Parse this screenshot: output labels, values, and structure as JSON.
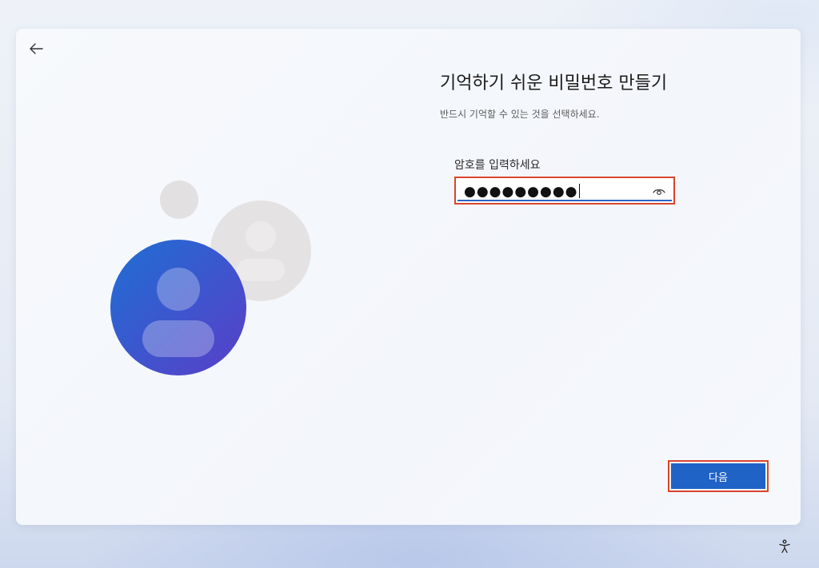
{
  "page": {
    "title": "기억하기 쉬운 비밀번호 만들기",
    "subtitle": "반드시 기억할 수 있는 것을 선택하세요."
  },
  "password_field": {
    "label": "암호를 입력하세요",
    "masked_value": "●●●●●●●●●",
    "reveal_icon": "eye-icon"
  },
  "buttons": {
    "next_label": "다음",
    "back_icon": "arrow-left-icon",
    "accessibility_icon": "accessibility-icon"
  },
  "colors": {
    "accent": "#1f63c6",
    "highlight_border": "#d9452c",
    "avatar_gradient_start": "#1e6fd4",
    "avatar_gradient_end": "#5a3ec8",
    "avatar_placeholder": "#e4e2e2"
  }
}
